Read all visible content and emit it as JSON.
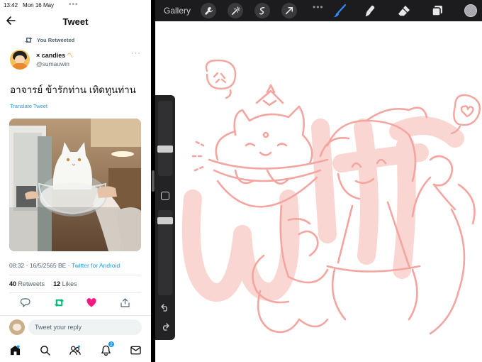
{
  "status_bar": {
    "time": "13:42",
    "date": "Mon 16 May",
    "dots": "•••"
  },
  "twitter": {
    "header_title": "Tweet",
    "retweet_label": "You Retweeted",
    "user": {
      "name": "× candies",
      "emoji": "〽",
      "handle": "@sumauwin"
    },
    "more": "···",
    "tweet_text": "อาจารย์ ข้ารักท่าน เทิดทูนท่าน",
    "translate": "Translate Tweet",
    "timestamp": "08:32 · 16/5/2565 BE · ",
    "client": "Twitter for Android",
    "stats": {
      "retweets": "40",
      "retweets_label": "Retweets",
      "likes": "12",
      "likes_label": "Likes"
    },
    "reply_placeholder": "Tweet your reply",
    "notification_count": "2",
    "colors": {
      "accent": "#1d9bf0",
      "retweet": "#00ba7c",
      "like": "#f91880"
    }
  },
  "procreate": {
    "gallery_label": "Gallery",
    "menu_dots": "•••",
    "colors": {
      "sketch": "#f4a5a0",
      "toolbar": "#1c1c1e",
      "active_tool": "#2f8cff"
    },
    "watermark": "wif"
  }
}
